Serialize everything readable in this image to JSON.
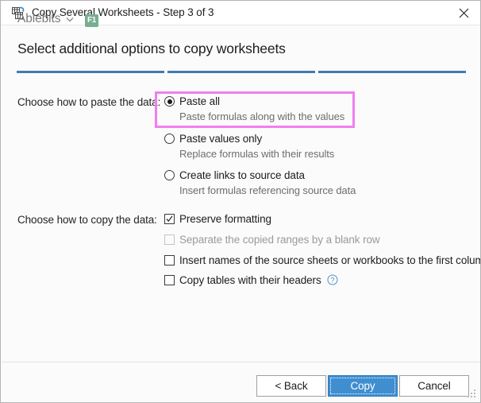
{
  "window": {
    "title": "Copy Several Worksheets - Step 3 of 3",
    "icon": "copy-worksheets-icon",
    "close_label": "✕"
  },
  "header": {
    "heading": "Select additional options to copy worksheets",
    "steps_total": 3,
    "current_step": 3,
    "step_color": "#3f7db0"
  },
  "highlight": {
    "color": "#f07ff0",
    "target": "Paste all"
  },
  "paste_section": {
    "label": "Choose how to paste the data:",
    "options": [
      {
        "label": "Paste all",
        "description": "Paste formulas along with the values",
        "selected": true
      },
      {
        "label": "Paste values only",
        "description": "Replace formulas with their results",
        "selected": false
      },
      {
        "label": "Create links to source data",
        "description": "Insert formulas referencing source data",
        "selected": false
      }
    ]
  },
  "copy_section": {
    "label": "Choose how to copy the data:",
    "options": [
      {
        "label": "Preserve formatting",
        "checked": true,
        "disabled": false,
        "help": false
      },
      {
        "label": "Separate the copied ranges by a blank row",
        "checked": false,
        "disabled": true,
        "help": false
      },
      {
        "label": "Insert names of the source sheets or workbooks to the first column",
        "checked": false,
        "disabled": false,
        "help": false
      },
      {
        "label": "Copy tables with their headers",
        "checked": false,
        "disabled": false,
        "help": true,
        "help_icon": "question-mark-circle-icon"
      }
    ]
  },
  "footer": {
    "brand": "Ablebits",
    "brand_chevron": "chevron-down-icon",
    "shortcut_badge": "F1",
    "shortcut_badge_color": "#77ae91",
    "buttons": {
      "back": "< Back",
      "copy": "Copy",
      "cancel": "Cancel"
    },
    "primary_color": "#3f8ed0"
  }
}
